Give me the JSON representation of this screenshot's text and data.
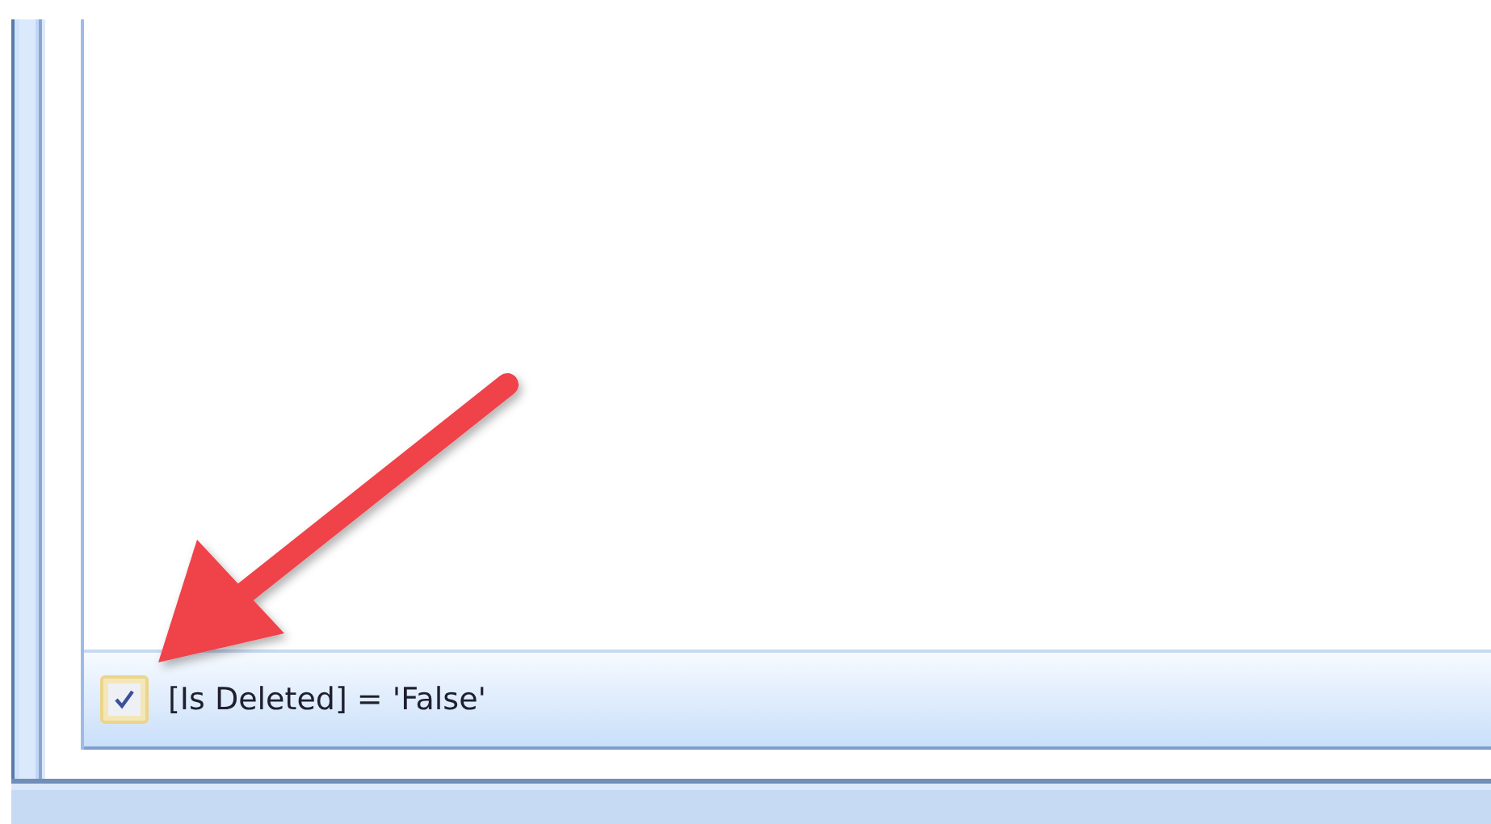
{
  "filter_bar": {
    "checked": true,
    "expression": "[Is Deleted] = 'False'"
  }
}
